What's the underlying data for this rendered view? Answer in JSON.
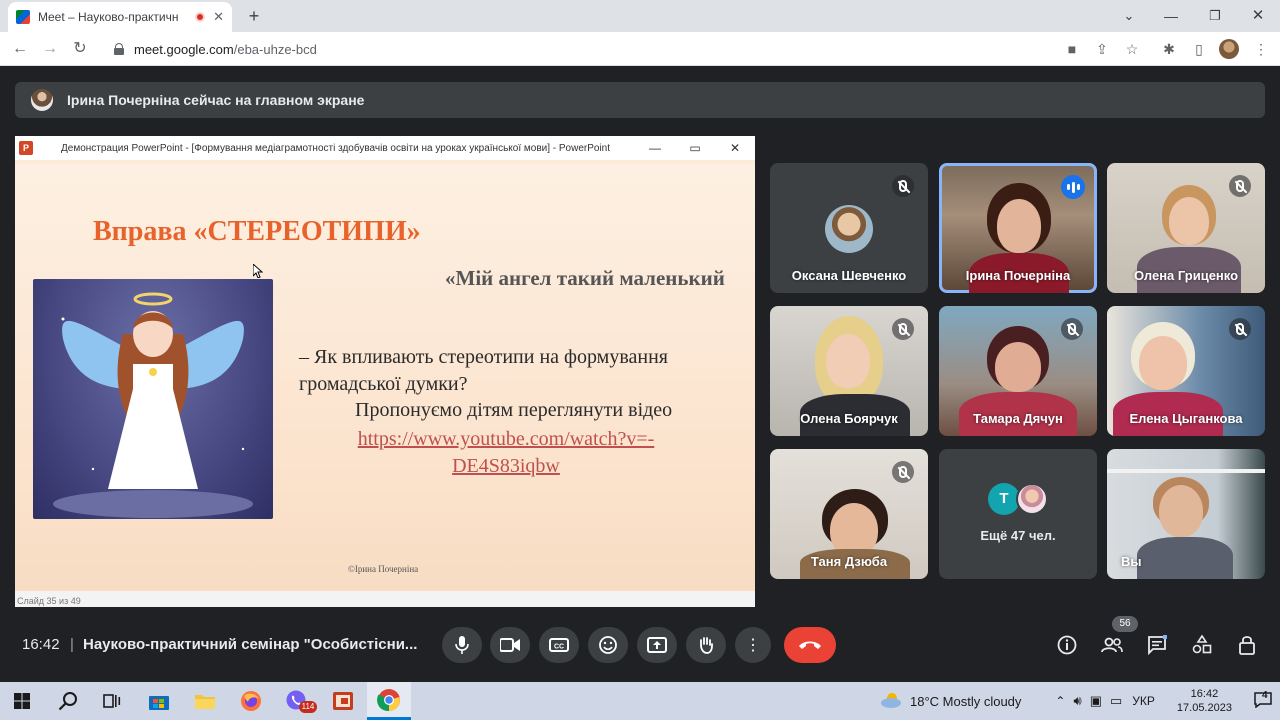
{
  "browser": {
    "tab_title": "Meet – Науково-практичн",
    "url_host": "meet.google.com",
    "url_path": "/eba-uhze-bcd"
  },
  "banner": {
    "text": "Ірина Почерніна сейчас на главном экране"
  },
  "presentation": {
    "window_title": "Демонстрация PowerPoint - [Формування медіаграмотності здобувачів освіти на уроках української мови] - PowerPoint",
    "slide_title": "Вправа «СТЕРЕОТИПИ»",
    "slide_subtitle": "«Мій ангел такий маленький",
    "question_line1": "– Як впливають стереотипи на формування",
    "question_line2": "громадської думки?",
    "proposal": "Пропонуємо дітям переглянути відео",
    "link_line1": "https://www.youtube.com/watch?v=-",
    "link_line2": "DE4S83iqbw",
    "copyright": "©Ірина Почерніна",
    "status": "Слайд 35 из 49"
  },
  "participants": [
    {
      "name": "Оксана Шевченко",
      "muted": true
    },
    {
      "name": "Ірина Почерніна",
      "speaking": true
    },
    {
      "name": "Олена Гриценко",
      "muted": true
    },
    {
      "name": "Олена Боярчук",
      "muted": true
    },
    {
      "name": "Тамара Дячун",
      "muted": true
    },
    {
      "name": "Елена Цыганкова",
      "muted": true
    },
    {
      "name": "Таня Дзюба",
      "muted": true
    },
    {
      "name": "Ещё 47 чел.",
      "avatar_letter": "T"
    },
    {
      "name": "Вы"
    }
  ],
  "bottom": {
    "time": "16:42",
    "meeting_name": "Науково-практичний семінар \"Особистісни...",
    "participant_count": "56"
  },
  "taskbar": {
    "weather": "18°C  Mostly cloudy",
    "lang": "УКР",
    "time": "16:42",
    "date": "17.05.2023",
    "notifications": "4",
    "viber_badge": "114"
  },
  "colors": {
    "accent": "#8ab4f8",
    "hangup": "#ea4335",
    "slide_title": "#e8622c"
  }
}
